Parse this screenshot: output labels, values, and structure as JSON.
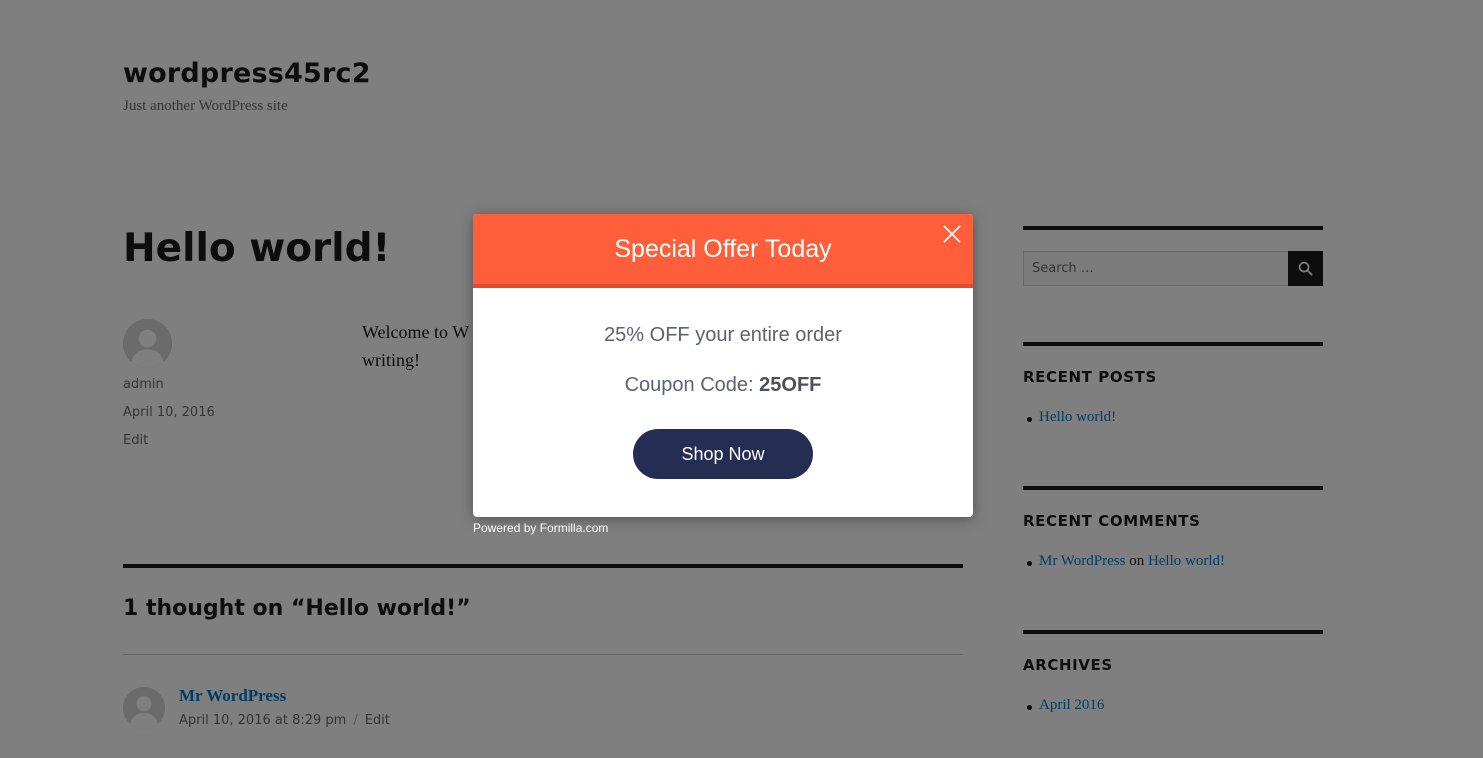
{
  "site": {
    "title": "wordpress45rc2",
    "description": "Just another WordPress site"
  },
  "post": {
    "title": "Hello world!",
    "author": "admin",
    "date": "April 10, 2016",
    "edit_label": "Edit",
    "content_visible": "Welcome to W",
    "content_line2": "writing!"
  },
  "comments": {
    "title": "1 thought on “Hello world!”",
    "items": [
      {
        "author": "Mr WordPress",
        "date": "April 10, 2016 at 8:29 pm",
        "separator": "/",
        "edit_label": "Edit"
      }
    ]
  },
  "sidebar": {
    "search": {
      "placeholder": "Search …",
      "button_icon": "search-icon"
    },
    "recent_posts": {
      "title": "RECENT POSTS",
      "items": [
        "Hello world!"
      ]
    },
    "recent_comments": {
      "title": "RECENT COMMENTS",
      "items": [
        {
          "author": "Mr WordPress",
          "on": "on",
          "post": "Hello world!"
        }
      ]
    },
    "archives": {
      "title": "ARCHIVES",
      "items": [
        "April 2016"
      ]
    }
  },
  "popup": {
    "title": "Special Offer Today",
    "close_icon": "close-icon",
    "offer": "25% OFF your entire order",
    "coupon_label": "Coupon Code:",
    "coupon_code": "25OFF",
    "cta_label": "Shop Now",
    "powered_by": "Powered by Formilla.com",
    "colors": {
      "header": "#ff5e3a",
      "button": "#252d52"
    }
  }
}
